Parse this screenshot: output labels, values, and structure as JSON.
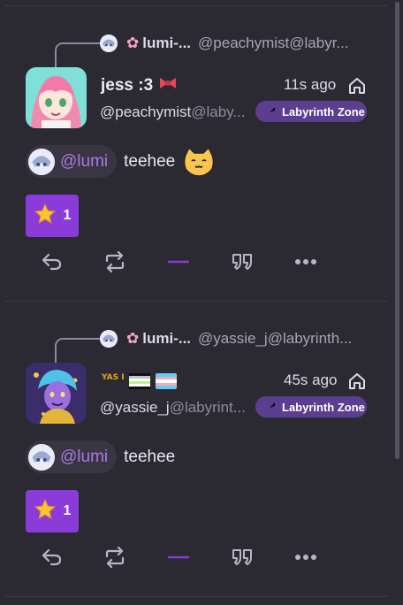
{
  "posts": [
    {
      "context_name": "lumi-...",
      "context_handle": "@peachymist@labyr...",
      "display_name": "jess :3",
      "time": "11s ago",
      "handle_user": "@peachymist",
      "handle_domain": "@laby...",
      "instance": "Labyrinth Zone",
      "mention": "@lumi",
      "text": "teehee",
      "reaction_count": "1",
      "has_emoji": true
    },
    {
      "context_name": "lumi-...",
      "context_handle": "@yassie_j@labyrinth...",
      "display_name": "",
      "time": "45s ago",
      "handle_user": "@yassie_j",
      "handle_domain": "@labyrint...",
      "instance": "Labyrinth Zone",
      "mention": "@lumi",
      "text": "teehee",
      "reaction_count": "1",
      "has_emoji": false
    }
  ],
  "icons": {
    "reply": "reply-icon",
    "boost": "repeat-icon",
    "like": "like-dash-icon",
    "quote": "quote-icon",
    "more": "more-icon",
    "visibility": "home-icon",
    "reaction": "star-icon"
  },
  "colors": {
    "background": "#2b2a33",
    "accent": "#8a3bd9",
    "instance_badge": "#5b3e8f",
    "mention_text": "#a97ae0",
    "muted_text": "#8f8b9e"
  },
  "badges": {
    "yas_eln_text": "YAS ELN"
  }
}
